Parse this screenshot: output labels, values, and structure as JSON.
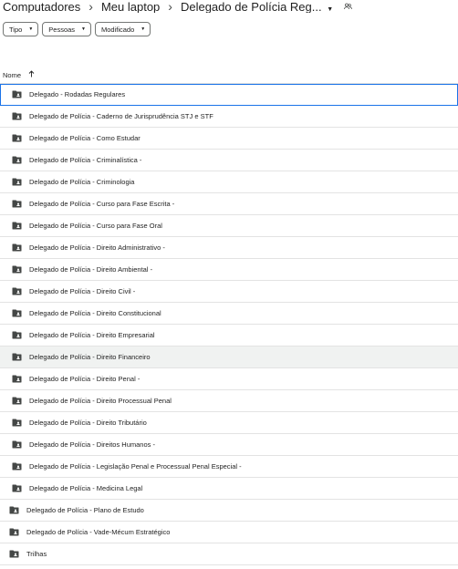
{
  "breadcrumb": {
    "root": "Computadores",
    "device": "Meu laptop",
    "current": "Delegado de Polícia Reg...",
    "caret_icon": "caret-down-icon",
    "shared_icon": "people-icon"
  },
  "filters": [
    {
      "label": "Tipo"
    },
    {
      "label": "Pessoas"
    },
    {
      "label": "Modificado"
    }
  ],
  "list_header": {
    "name_label": "Nome",
    "sort_icon": "arrow-up-icon"
  },
  "folders": [
    {
      "name": "Delegado - Rodadas Regulares",
      "selected": true
    },
    {
      "name": "Delegado de Polícia - Caderno de Jurisprudência STJ e STF"
    },
    {
      "name": "Delegado de Polícia - Como Estudar"
    },
    {
      "name": "Delegado de Polícia - Criminalística -"
    },
    {
      "name": "Delegado de Polícia - Criminologia"
    },
    {
      "name": "Delegado de Polícia - Curso para Fase Escrita -"
    },
    {
      "name": "Delegado de Polícia - Curso para Fase Oral"
    },
    {
      "name": "Delegado de Polícia - Direito Administrativo -"
    },
    {
      "name": "Delegado de Polícia - Direito Ambiental -"
    },
    {
      "name": "Delegado de Polícia - Direito Civil -"
    },
    {
      "name": "Delegado de Polícia - Direito Constitucional"
    },
    {
      "name": "Delegado de Polícia - Direito Empresarial"
    },
    {
      "name": "Delegado de Polícia - Direito Financeiro",
      "hover": true
    },
    {
      "name": "Delegado de Polícia - Direito Penal -"
    },
    {
      "name": "Delegado de Polícia - Direito Processual Penal"
    },
    {
      "name": "Delegado de Polícia - Direito Tributário"
    },
    {
      "name": "Delegado de Polícia - Direitos Humanos -"
    },
    {
      "name": "Delegado de Polícia - Legislação Penal e Processual Penal Especial -"
    },
    {
      "name": "Delegado de Polícia - Medicina Legal"
    },
    {
      "name": "Delegado de Polícia - Plano de Estudo"
    },
    {
      "name": "Delegado de Polícia - Vade-Mécum Estratégico"
    },
    {
      "name": "Trilhas"
    }
  ],
  "colors": {
    "selection_outline": "#1a73e8",
    "hover_bg": "#f0f2f1",
    "folder_icon": "#444746"
  }
}
